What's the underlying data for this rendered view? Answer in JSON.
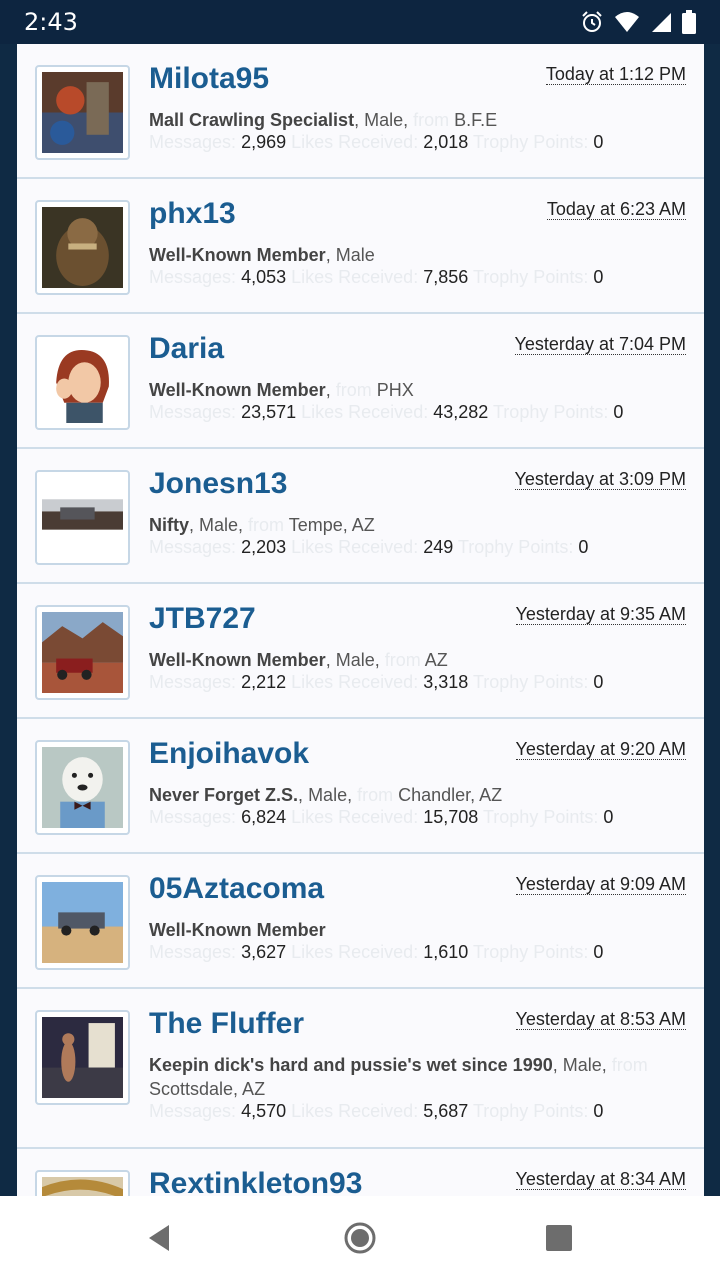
{
  "status_bar": {
    "time": "2:43"
  },
  "members": [
    {
      "username": "Milota95",
      "last_seen": "Today at 1:12 PM",
      "title": "Mall Crawling Specialist",
      "gender": "Male",
      "from_label": "from",
      "location": "B.F.E",
      "messages_label": "Messages:",
      "messages": "2,969",
      "likes_label": "Likes Received:",
      "likes": "2,018",
      "trophy_label": "Trophy Points:",
      "trophy": "0"
    },
    {
      "username": "phx13",
      "last_seen": "Today at 6:23 AM",
      "title": "Well-Known Member",
      "gender": "Male",
      "messages_label": "Messages:",
      "messages": "4,053",
      "likes_label": "Likes Received:",
      "likes": "7,856",
      "trophy_label": "Trophy Points:",
      "trophy": "0"
    },
    {
      "username": "Daria",
      "last_seen": "Yesterday at 7:04 PM",
      "title": "Well-Known Member",
      "from_label": "from",
      "location": "PHX",
      "messages_label": "Messages:",
      "messages": "23,571",
      "likes_label": "Likes Received:",
      "likes": "43,282",
      "trophy_label": "Trophy Points:",
      "trophy": "0"
    },
    {
      "username": "Jonesn13",
      "last_seen": "Yesterday at 3:09 PM",
      "title": "Nifty",
      "gender": "Male",
      "from_label": "from",
      "location": "Tempe, AZ",
      "messages_label": "Messages:",
      "messages": "2,203",
      "likes_label": "Likes Received:",
      "likes": "249",
      "trophy_label": "Trophy Points:",
      "trophy": "0"
    },
    {
      "username": "JTB727",
      "last_seen": "Yesterday at 9:35 AM",
      "title": "Well-Known Member",
      "gender": "Male",
      "from_label": "from",
      "location": "AZ",
      "messages_label": "Messages:",
      "messages": "2,212",
      "likes_label": "Likes Received:",
      "likes": "3,318",
      "trophy_label": "Trophy Points:",
      "trophy": "0"
    },
    {
      "username": "Enjoihavok",
      "last_seen": "Yesterday at 9:20 AM",
      "title": "Never Forget Z.S.",
      "gender": "Male",
      "from_label": "from",
      "location": "Chandler, AZ",
      "messages_label": "Messages:",
      "messages": "6,824",
      "likes_label": "Likes Received:",
      "likes": "15,708",
      "trophy_label": "Trophy Points:",
      "trophy": "0"
    },
    {
      "username": "05Aztacoma",
      "last_seen": "Yesterday at 9:09 AM",
      "title": "Well-Known Member",
      "messages_label": "Messages:",
      "messages": "3,627",
      "likes_label": "Likes Received:",
      "likes": "1,610",
      "trophy_label": "Trophy Points:",
      "trophy": "0"
    },
    {
      "username": "The Fluffer",
      "last_seen": "Yesterday at 8:53 AM",
      "title": "Keepin dick's hard and pussie's wet since 1990",
      "gender": "Male",
      "from_label": "from",
      "location": "Scottsdale, AZ",
      "messages_label": "Messages:",
      "messages": "4,570",
      "likes_label": "Likes Received:",
      "likes": "5,687",
      "trophy_label": "Trophy Points:",
      "trophy": "0"
    },
    {
      "username": "Rextinkleton93",
      "last_seen": "Yesterday at 8:34 AM"
    }
  ],
  "icons": {
    "alarm": "alarm-icon",
    "wifi": "wifi-icon",
    "signal": "signal-icon",
    "battery": "battery-icon",
    "back": "back-icon",
    "home": "home-icon",
    "recents": "recents-icon"
  },
  "colors": {
    "username": "#1b5d91",
    "status_bar": "#0d2540",
    "page_bg": "#0f2a44"
  }
}
